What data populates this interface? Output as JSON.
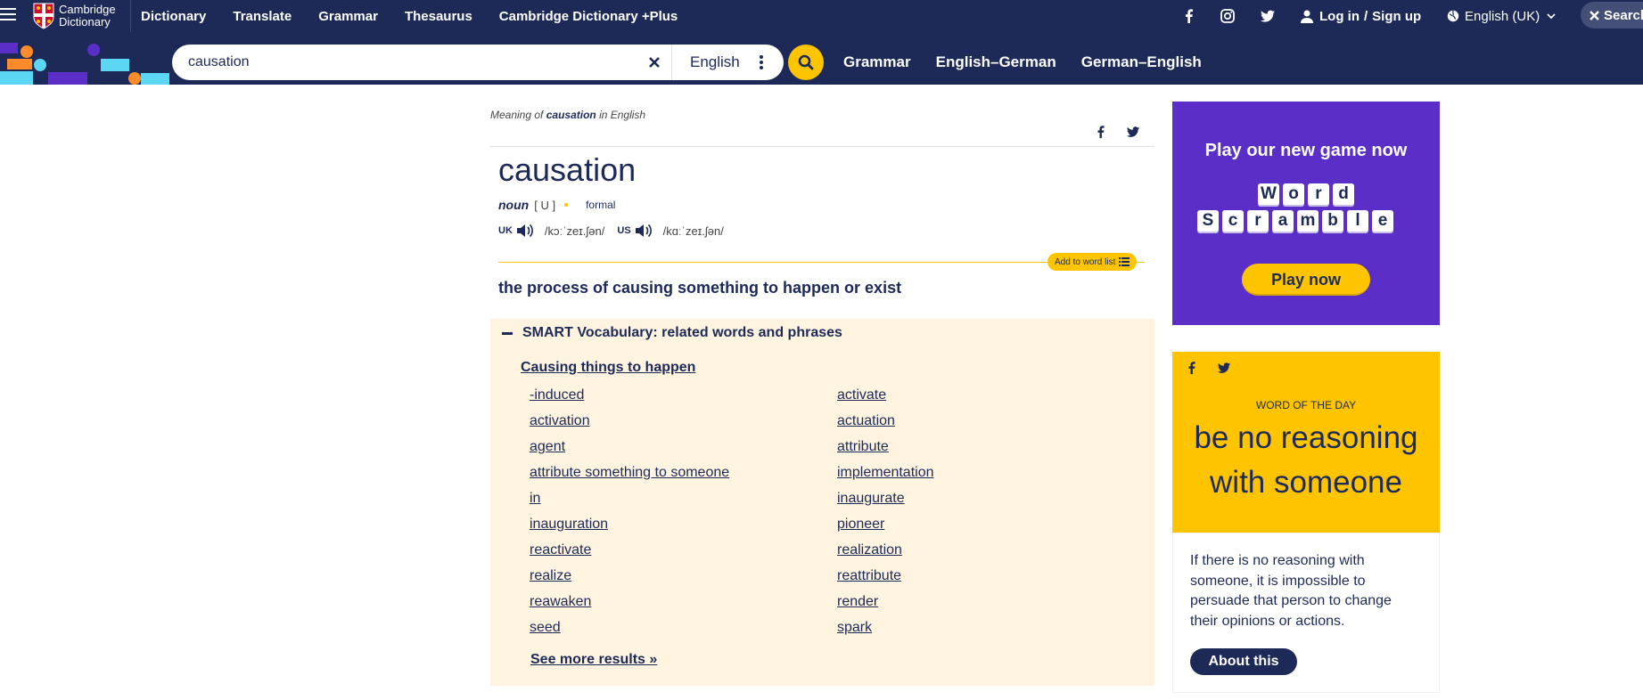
{
  "brand": {
    "name_line1": "Cambridge",
    "name_line2": "Dictionary"
  },
  "topnav": {
    "links": [
      "Dictionary",
      "Translate",
      "Grammar",
      "Thesaurus",
      "Cambridge Dictionary +Plus"
    ],
    "login": "Log in",
    "signup": "Sign up",
    "login_sep": "/",
    "language": "English (UK)",
    "search_label": "Search"
  },
  "search": {
    "value": "causation",
    "dictionary": "English",
    "quick_links": [
      "Grammar",
      "English–German",
      "German–English"
    ]
  },
  "entry": {
    "meaning_prefix": "Meaning of",
    "meaning_word": "causation",
    "meaning_suffix": "in English",
    "headword": "causation",
    "pos": "noun",
    "grammar": "[ U ]",
    "register": "formal",
    "uk_label": "UK",
    "uk_ipa": "/kɔːˈzeɪ.ʃən/",
    "us_label": "US",
    "us_ipa": "/kɑːˈzeɪ.ʃən/",
    "add_to_list": "Add to word list",
    "definition": "the process of causing something to happen or exist"
  },
  "smart_vocab": {
    "heading": "SMART Vocabulary: related words and phrases",
    "category": "Causing things to happen",
    "left_column": [
      "-induced",
      "activation",
      "agent",
      "attribute something to someone",
      "in",
      "inauguration",
      "reactivate",
      "realize",
      "reawaken",
      "seed"
    ],
    "right_column": [
      "activate",
      "actuation",
      "attribute",
      "implementation",
      "inaugurate",
      "pioneer",
      "realization",
      "reattribute",
      "render",
      "spark"
    ],
    "see_more": "See more results »"
  },
  "ad": {
    "title": "Play our new game now",
    "word1": [
      "W",
      "o",
      "r",
      "d"
    ],
    "word2": [
      "S",
      "c",
      "r",
      "a",
      "m",
      "b",
      "l",
      "e"
    ],
    "button": "Play now"
  },
  "word_of_the_day": {
    "label": "WORD OF THE DAY",
    "phrase": "be no reasoning with someone",
    "definition": "If there is no reasoning with someone, it is impossible to persuade that person to change their opinions or actions.",
    "button": "About this"
  },
  "colors": {
    "navy": "#1d2a57",
    "yellow": "#fec400",
    "purple": "#5b2ec7",
    "cream": "#fff4e0"
  }
}
